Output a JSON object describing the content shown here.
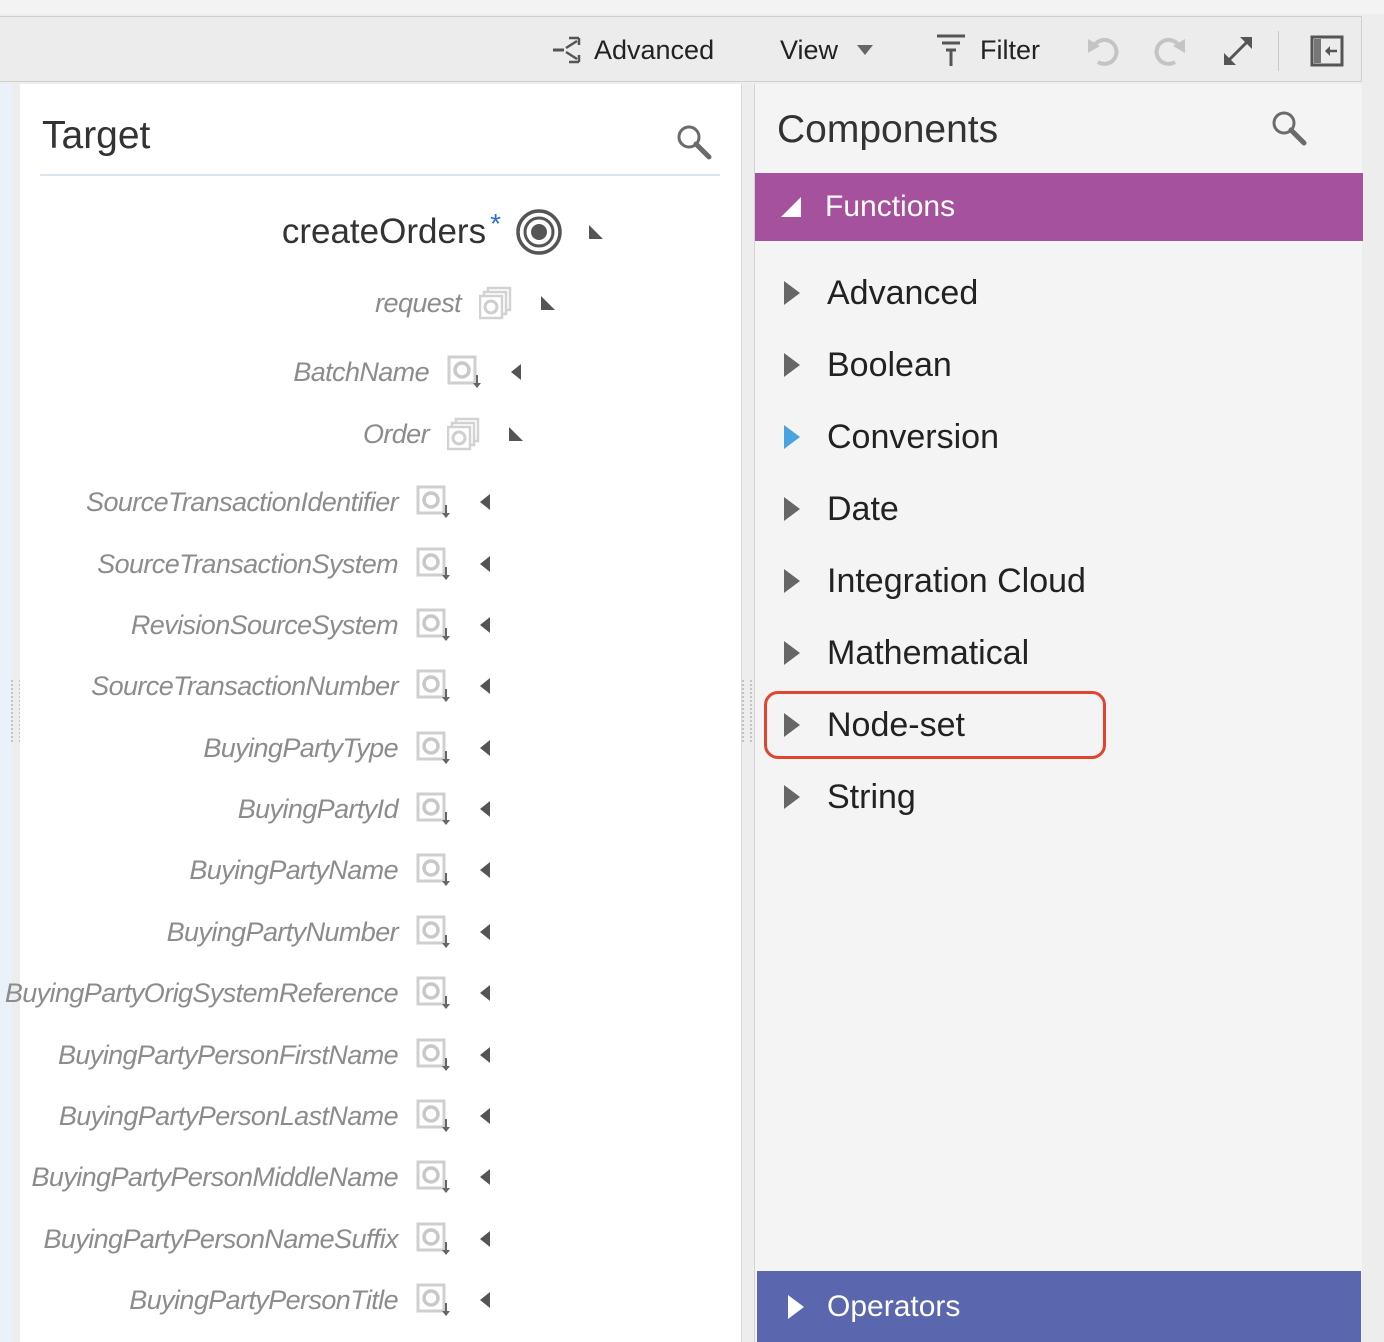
{
  "toolbar": {
    "advanced_label": "Advanced",
    "view_label": "View",
    "filter_label": "Filter",
    "icons": [
      "advanced-icon",
      "view-dropdown-icon",
      "filter-icon",
      "undo-icon",
      "redo-icon",
      "expand-icon",
      "panel-toggle-icon"
    ]
  },
  "target": {
    "title": "Target",
    "tree": [
      {
        "label": "createOrders",
        "required": "*",
        "icon": "target-root-icon",
        "arrow": "expanded"
      },
      {
        "label": "request",
        "icon": "repeating-node-icon",
        "arrow": "expanded"
      },
      {
        "label": "BatchName",
        "icon": "element-node-icon",
        "arrow": "collapsed"
      },
      {
        "label": "Order",
        "icon": "repeating-node-icon",
        "arrow": "expanded"
      },
      {
        "label": "SourceTransactionIdentifier",
        "icon": "element-node-icon",
        "arrow": "collapsed"
      },
      {
        "label": "SourceTransactionSystem",
        "icon": "element-node-icon",
        "arrow": "collapsed"
      },
      {
        "label": "RevisionSourceSystem",
        "icon": "element-node-icon",
        "arrow": "collapsed"
      },
      {
        "label": "SourceTransactionNumber",
        "icon": "element-node-icon",
        "arrow": "collapsed"
      },
      {
        "label": "BuyingPartyType",
        "icon": "element-node-icon",
        "arrow": "collapsed"
      },
      {
        "label": "BuyingPartyId",
        "icon": "element-node-icon",
        "arrow": "collapsed"
      },
      {
        "label": "BuyingPartyName",
        "icon": "element-node-icon",
        "arrow": "collapsed"
      },
      {
        "label": "BuyingPartyNumber",
        "icon": "element-node-icon",
        "arrow": "collapsed"
      },
      {
        "label": "BuyingPartyOrigSystemReference",
        "icon": "element-node-icon",
        "arrow": "collapsed"
      },
      {
        "label": "BuyingPartyPersonFirstName",
        "icon": "element-node-icon",
        "arrow": "collapsed"
      },
      {
        "label": "BuyingPartyPersonLastName",
        "icon": "element-node-icon",
        "arrow": "collapsed"
      },
      {
        "label": "BuyingPartyPersonMiddleName",
        "icon": "element-node-icon",
        "arrow": "collapsed"
      },
      {
        "label": "BuyingPartyPersonNameSuffix",
        "icon": "element-node-icon",
        "arrow": "collapsed"
      },
      {
        "label": "BuyingPartyPersonTitle",
        "icon": "element-node-icon",
        "arrow": "collapsed"
      }
    ]
  },
  "components": {
    "title": "Components",
    "functions_label": "Functions",
    "functions_color": "#a6519e",
    "functions": [
      {
        "label": "Advanced"
      },
      {
        "label": "Boolean"
      },
      {
        "label": "Conversion",
        "active": true
      },
      {
        "label": "Date"
      },
      {
        "label": "Integration Cloud"
      },
      {
        "label": "Mathematical"
      },
      {
        "label": "Node-set",
        "highlighted": true
      },
      {
        "label": "String"
      }
    ],
    "operators_label": "Operators",
    "operators_color": "#5a66ad",
    "highlight_color": "#e2452f"
  }
}
